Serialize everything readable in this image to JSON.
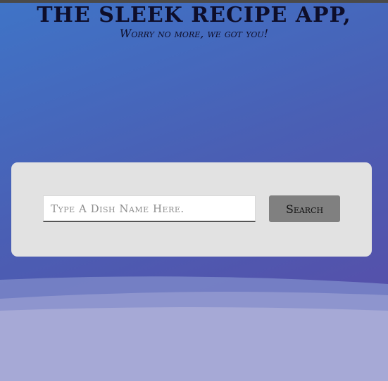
{
  "header": {
    "title": "THE SLEEK RECIPE APP,",
    "subtitle": "Worry no more, we got you!"
  },
  "search": {
    "placeholder": "Type A Dish Name Here.",
    "value": "",
    "button_label": "Search"
  },
  "colors": {
    "background_start": "#3f74c7",
    "background_end": "#5a4aa6",
    "card": "#e2e2e2",
    "button": "#808080",
    "title_text": "#0e0e2a"
  }
}
